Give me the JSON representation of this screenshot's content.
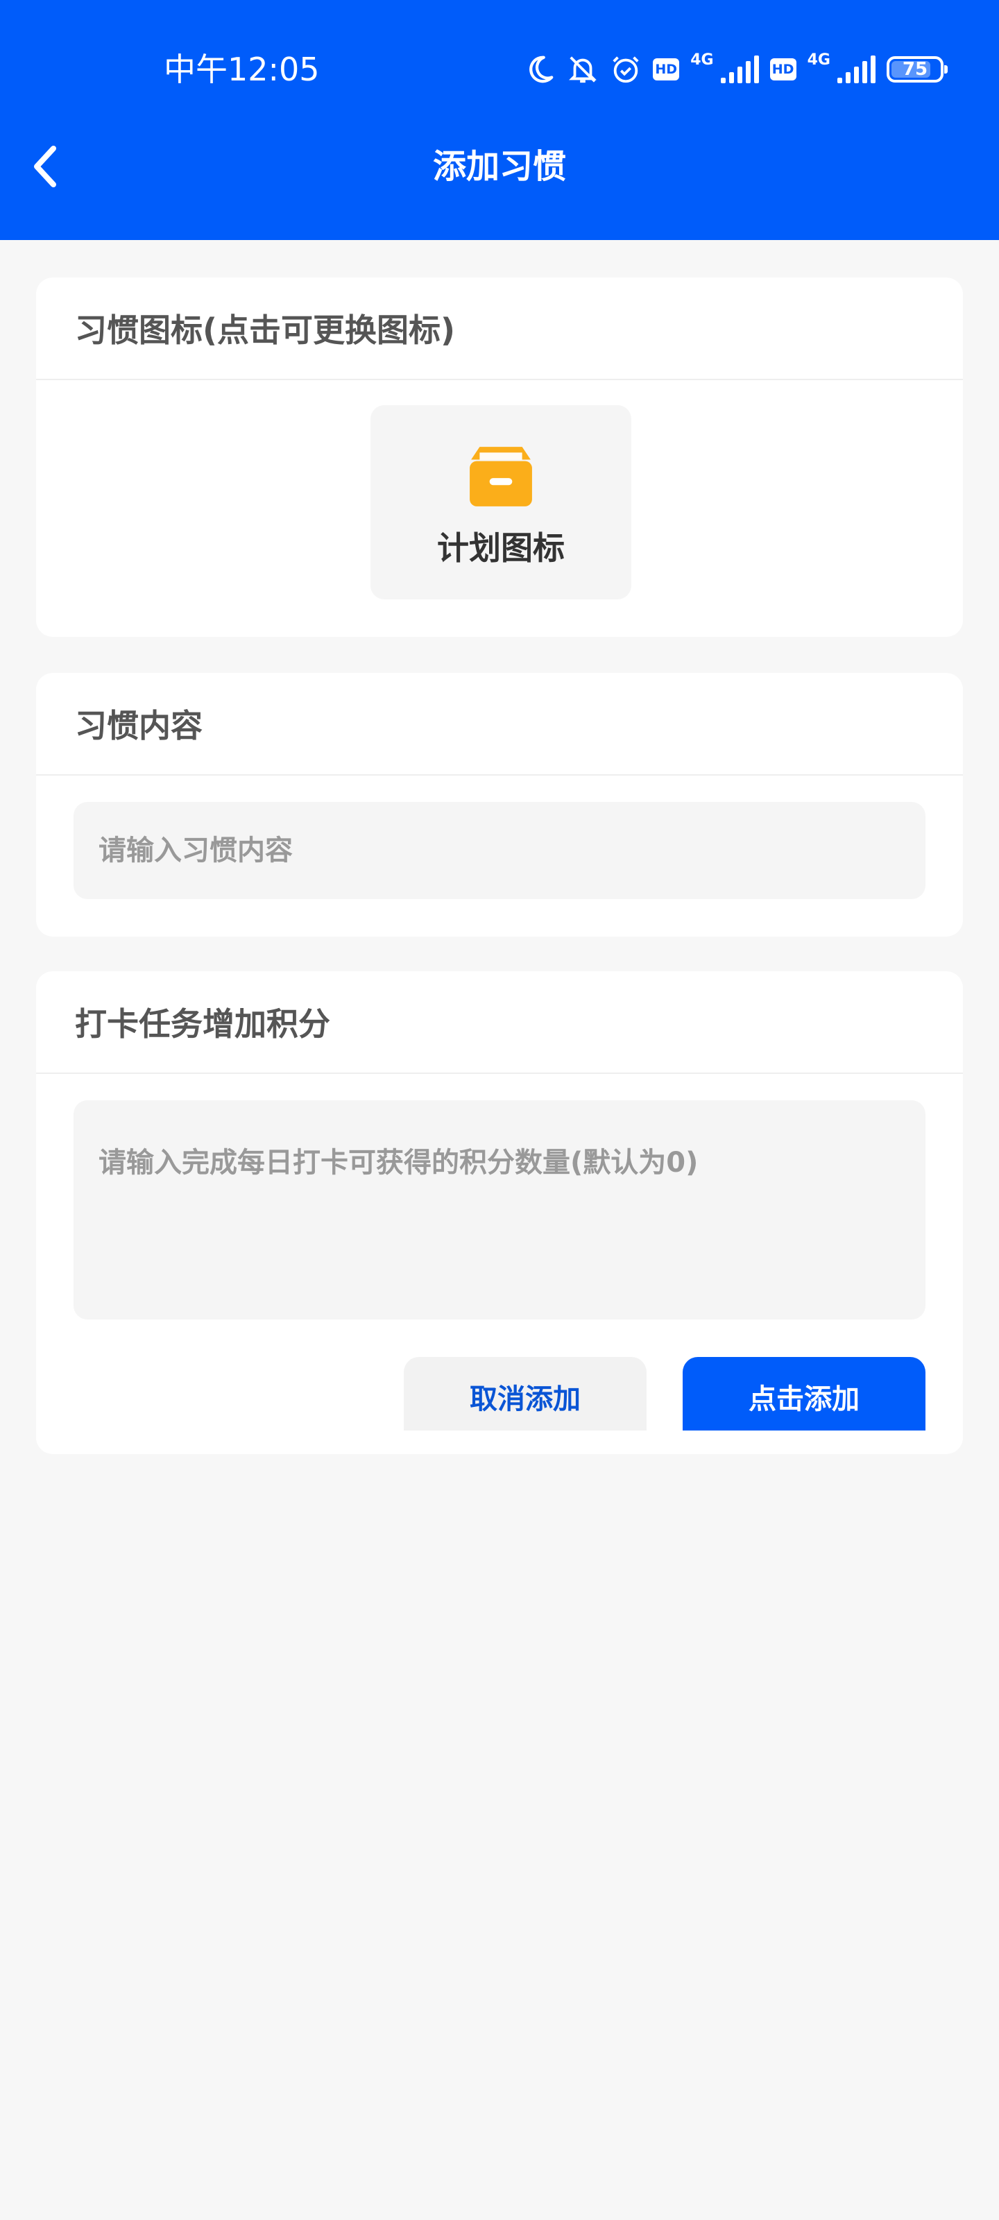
{
  "status_bar": {
    "time": "中午12:05",
    "network_1": "4G",
    "network_2": "4G",
    "hd_label": "HD",
    "battery": "75"
  },
  "header": {
    "title": "添加习惯"
  },
  "icon_card": {
    "title": "习惯图标(点击可更换图标)",
    "icon_label": "计划图标",
    "icon_color": "#fbae1a"
  },
  "content_card": {
    "title": "习惯内容",
    "placeholder": "请输入习惯内容"
  },
  "points_card": {
    "title": "打卡任务增加积分",
    "placeholder": "请输入完成每日打卡可获得的积分数量(默认为0)",
    "cancel_label": "取消添加",
    "add_label": "点击添加"
  },
  "colors": {
    "primary": "#005cfa",
    "background": "#f7f7f7"
  }
}
